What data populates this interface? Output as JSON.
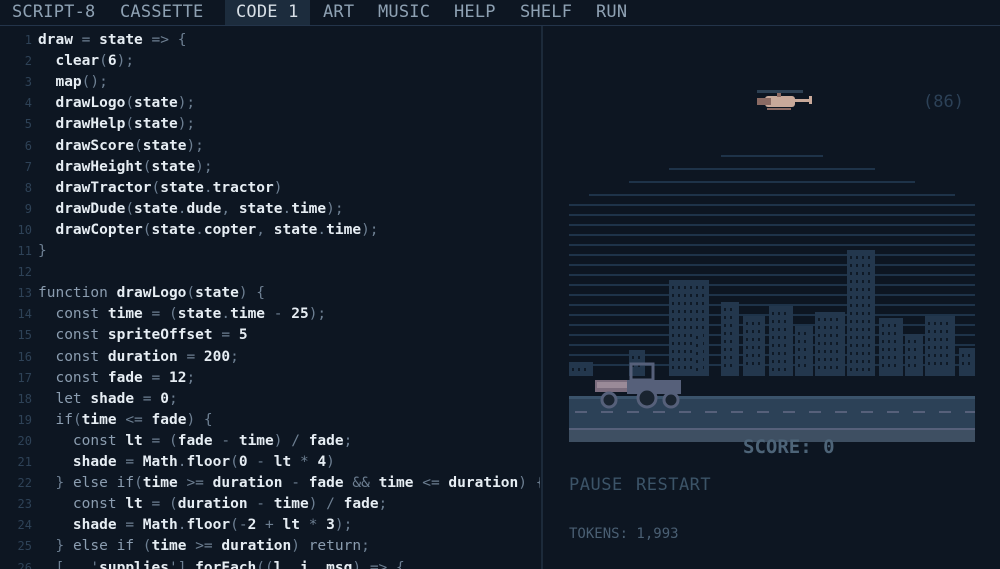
{
  "menu": {
    "items": [
      {
        "label": "SCRIPT-8",
        "active": false
      },
      {
        "label": "CASSETTE",
        "active": false
      },
      {
        "label": "CODE 1",
        "active": true
      },
      {
        "label": "ART",
        "active": false
      },
      {
        "label": "MUSIC",
        "active": false
      },
      {
        "label": "HELP",
        "active": false
      },
      {
        "label": "SHELF",
        "active": false
      },
      {
        "label": "RUN",
        "active": false
      }
    ]
  },
  "editor": {
    "lines": [
      "draw = state => {",
      "  clear(6);",
      "  map();",
      "  drawLogo(state);",
      "  drawHelp(state);",
      "  drawScore(state);",
      "  drawHeight(state);",
      "  drawTractor(state.tractor)",
      "  drawDude(state.dude, state.time);",
      "  drawCopter(state.copter, state.time);",
      "}",
      "",
      "function drawLogo(state) {",
      "  const time = (state.time - 25);",
      "  const spriteOffset = 5",
      "  const duration = 200;",
      "  const fade = 12;",
      "  let shade = 0;",
      "  if(time <= fade) {",
      "    const lt = (fade - time) / fade;",
      "    shade = Math.floor(0 - lt * 4)",
      "  } else if(time >= duration - fade && time <= duration) {",
      "    const lt = (duration - time) / fade;",
      "    shade = Math.floor(-2 + lt * 3);",
      "  } else if (time >= duration) return;",
      "  [...'supplies'].forEach((l, i, msg) => {"
    ]
  },
  "game": {
    "height_readout": "(86)",
    "score_label": "SCORE: 0",
    "colors": {
      "background": "#0d1622",
      "stripes": "#1e3349",
      "buildings": "#23374d",
      "road": "#2c4157",
      "tractor": "#56607a",
      "score_text": "#4d6478"
    }
  },
  "controls": {
    "pause_label": "PAUSE",
    "restart_label": "RESTART"
  },
  "status": {
    "tokens_label": "TOKENS: 1,993"
  }
}
